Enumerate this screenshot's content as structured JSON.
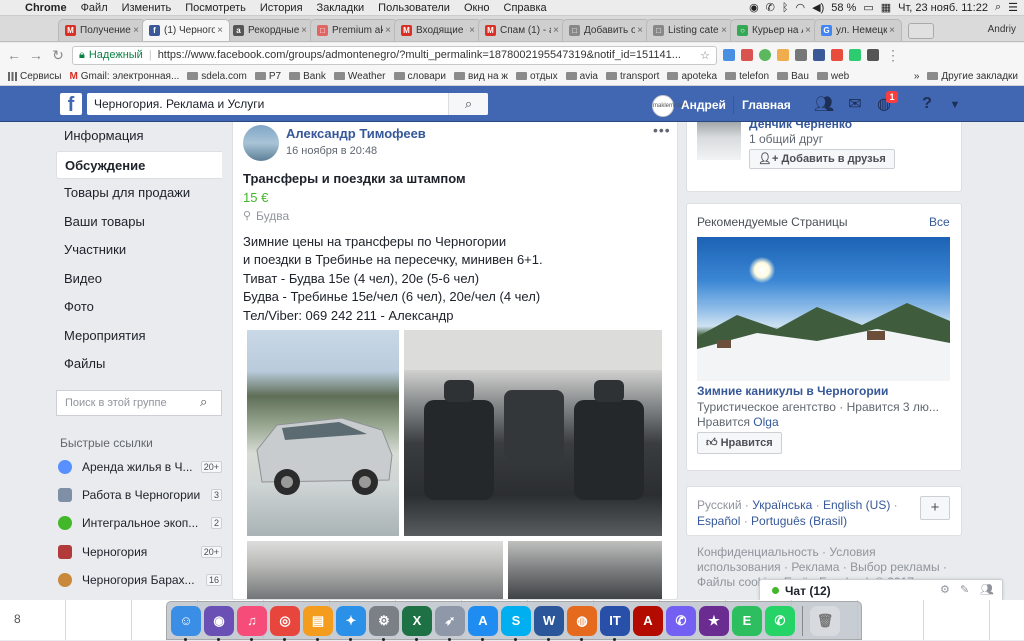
{
  "menubar": {
    "app": "Chrome",
    "items": [
      "Файл",
      "Изменить",
      "Посмотреть",
      "История",
      "Закладки",
      "Пользователи",
      "Окно",
      "Справка"
    ],
    "battery": "58 %",
    "clock": "Чт, 23 нояб.  11:22"
  },
  "tabs": [
    {
      "label": "Получение",
      "color": "#d93025",
      "glyph": "M"
    },
    {
      "label": "(1) Черногор",
      "color": "#3b5998",
      "glyph": "f"
    },
    {
      "label": "Рекордные",
      "color": "#555555",
      "glyph": "a"
    },
    {
      "label": "Premium ak",
      "color": "#e06666",
      "glyph": "□"
    },
    {
      "label": "Входящие (",
      "color": "#d93025",
      "glyph": "M"
    },
    {
      "label": "Спам (1) - al",
      "color": "#d93025",
      "glyph": "M"
    },
    {
      "label": "Добавить of",
      "color": "#888888",
      "glyph": "□"
    },
    {
      "label": "Listing categ",
      "color": "#888888",
      "glyph": "□"
    },
    {
      "label": "Курьер на A",
      "color": "#34a853",
      "glyph": "○"
    },
    {
      "label": "ул. Немецка",
      "color": "#4285f4",
      "glyph": "G"
    }
  ],
  "tab_user": "Andriy",
  "omnibox": {
    "secure_label": "Надежный",
    "url": "https://www.facebook.com/groups/admontenegro/?multi_permalink=1878002195547319&notif_id=151141..."
  },
  "bookmarks": {
    "items": [
      {
        "label": "Сервисы",
        "type": "apps"
      },
      {
        "label": "Gmail: электронная...",
        "type": "gmail"
      },
      {
        "label": "sdela.com",
        "type": "folder"
      },
      {
        "label": "P7",
        "type": "folder"
      },
      {
        "label": "Bank",
        "type": "folder"
      },
      {
        "label": "Weather",
        "type": "folder"
      },
      {
        "label": "словари",
        "type": "folder"
      },
      {
        "label": "вид на ж",
        "type": "folder"
      },
      {
        "label": "отдых",
        "type": "folder"
      },
      {
        "label": "avia",
        "type": "folder"
      },
      {
        "label": "transport",
        "type": "folder"
      },
      {
        "label": "apoteka",
        "type": "folder"
      },
      {
        "label": "telefon",
        "type": "folder"
      },
      {
        "label": "Bau",
        "type": "folder"
      },
      {
        "label": "web",
        "type": "folder"
      }
    ],
    "other": "Другие закладки"
  },
  "fb": {
    "search_value": "Черногория. Реклама и Услуги",
    "avatar_text": "maklerni.net",
    "user": "Андрей",
    "home": "Главная",
    "notif_count": "1"
  },
  "leftnav": {
    "items": [
      {
        "label": "Информация",
        "active": false
      },
      {
        "label": "Обсуждение",
        "active": true
      },
      {
        "label": "Товары для продажи",
        "active": false
      },
      {
        "label": "Ваши товары",
        "active": false
      },
      {
        "label": "Участники",
        "active": false
      },
      {
        "label": "Видео",
        "active": false
      },
      {
        "label": "Фото",
        "active": false
      },
      {
        "label": "Мероприятия",
        "active": false
      },
      {
        "label": "Файлы",
        "active": false
      }
    ],
    "search_placeholder": "Поиск в этой группе",
    "quick_title": "Быстрые ссылки",
    "quick": [
      {
        "label": "Аренда жилья в Ч...",
        "count": "20+",
        "color": "#5890ff"
      },
      {
        "label": "Работа в Черногории",
        "count": "3",
        "color": "#7f8fa6"
      },
      {
        "label": "Интегральное экоп...",
        "count": "2",
        "color": "#42b72a"
      },
      {
        "label": "Черногория",
        "count": "20+",
        "color": "#b33a3a"
      },
      {
        "label": "Черногория Барах...",
        "count": "16",
        "color": "#c8893a"
      }
    ]
  },
  "post": {
    "author": "Александр Тимофеев",
    "time": "16 ноября в 20:48",
    "title": "Трансферы и поездки за штампом",
    "price": "15 €",
    "location": "Будва",
    "lines": [
      "Зимние цены на трансферы по Черногории",
      "и поездки в Требинье на пересечку, минивен 6+1.",
      "Тиват - Будва 15е (4 чел), 20е (5-6 чел)",
      "Будва - Требинье 15е/чел (6 чел), 20е/чел (4 чел)",
      "Тел/Viber: 069 242 211 - Александр"
    ]
  },
  "right": {
    "friend": {
      "name": "Денчик Черненко",
      "mutual": "1 общий друг",
      "add_label": "Добавить в друзья"
    },
    "reco": {
      "title": "Рекомендуемые Страницы",
      "all": "Все",
      "page_name": "Зимние каникулы в Черногории",
      "desc": "Туристическое агентство · Нравится 3 лю...",
      "likes_prefix": "Нравится ",
      "likes_name": "Olga",
      "like_label": "Нравится"
    },
    "languages": {
      "current": "Русский",
      "row1": [
        "Українська",
        "English (US)"
      ],
      "row2": [
        "Español",
        "Português (Brasil)"
      ],
      "plus": "+"
    },
    "footer": "Конфиденциальность · Условия использования · Реклама · Выбор рекламы · Файлы cookie · Ещё · Facebook © 2017"
  },
  "chat": {
    "label": "Чат (12)"
  },
  "sheet_row": "8",
  "dock": [
    {
      "name": "finder-icon",
      "color": "#3a8ee6",
      "glyph": "☺"
    },
    {
      "name": "siri-icon",
      "color": "#6a4fb5",
      "glyph": "◉"
    },
    {
      "name": "itunes-icon",
      "color": "#f64c7a",
      "glyph": "♫"
    },
    {
      "name": "chrome-icon",
      "color": "#e8453c",
      "glyph": "◎"
    },
    {
      "name": "ibooks-icon",
      "color": "#f39c1e",
      "glyph": "▤"
    },
    {
      "name": "safari-icon",
      "color": "#2a90e8",
      "glyph": "✦"
    },
    {
      "name": "system-preferences-icon",
      "color": "#7b7f86",
      "glyph": "⚙"
    },
    {
      "name": "excel-icon",
      "color": "#1e7145",
      "glyph": "X"
    },
    {
      "name": "launchpad-icon",
      "color": "#8e98a8",
      "glyph": "➶"
    },
    {
      "name": "app-store-icon",
      "color": "#1e8cf0",
      "glyph": "A"
    },
    {
      "name": "skype-icon",
      "color": "#00aff0",
      "glyph": "S"
    },
    {
      "name": "word-icon",
      "color": "#2b579a",
      "glyph": "W"
    },
    {
      "name": "firefox-icon",
      "color": "#e66a1e",
      "glyph": "◍"
    },
    {
      "name": "it-app-icon",
      "color": "#2850a8",
      "glyph": "IT"
    },
    {
      "name": "acrobat-icon",
      "color": "#b30b00",
      "glyph": "A"
    },
    {
      "name": "viber-icon",
      "color": "#7360f2",
      "glyph": "✆"
    },
    {
      "name": "star-app-icon",
      "color": "#6b2c91",
      "glyph": "★"
    },
    {
      "name": "evernote-icon",
      "color": "#2dbe60",
      "glyph": "E"
    },
    {
      "name": "whatsapp-icon",
      "color": "#25d366",
      "glyph": "✆"
    }
  ]
}
